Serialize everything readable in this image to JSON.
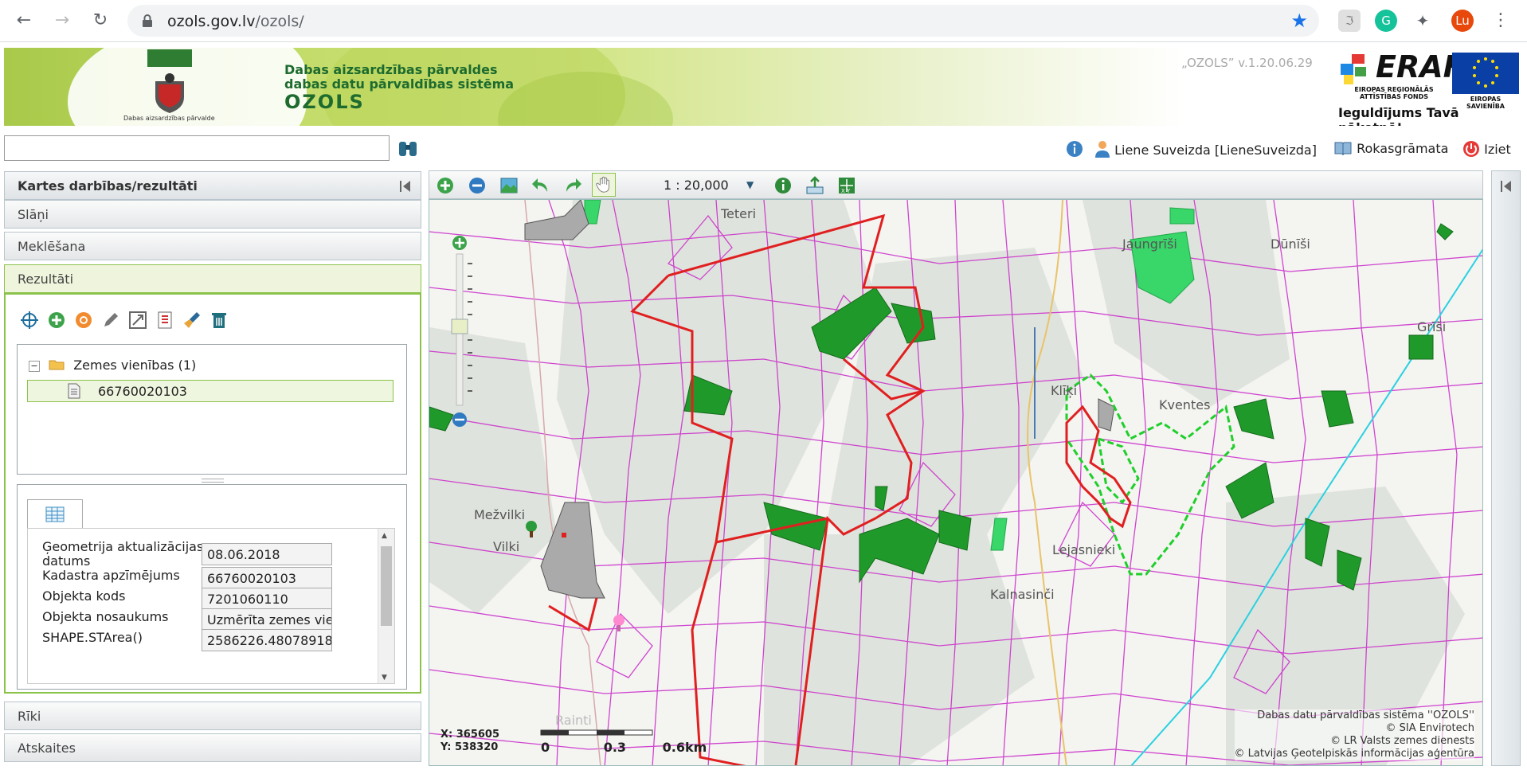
{
  "browser": {
    "url_host": "ozols.gov.lv",
    "url_path": "/ozols/",
    "avatar": "Lu"
  },
  "header": {
    "coat_label": "Dabas aizsardzības pārvalde",
    "title_line1": "Dabas aizsardzības pārvaldes",
    "title_line2": "dabas datu pārvaldības sistēma",
    "title_line3": "OZOLS",
    "version": "„OZOLS” v.1.20.06.29",
    "eraf": "ERAF",
    "eraf_sub": "EIROPAS REĢIONĀLĀS ATTĪSTĪBAS FONDS",
    "eu_sub": "EIROPAS SAVIENĪBA",
    "slogan": "Ieguldījums Tavā nākotnē!"
  },
  "userbar": {
    "user": "Liene Suveizda [LieneSuveizda]",
    "manual": "Rokasgrāmata",
    "logout": "Iziet"
  },
  "panel": {
    "title": "Kartes darbības/rezultāti",
    "sections": [
      "Slāņi",
      "Meklēšana",
      "Rezultāti",
      "Rīki",
      "Atskaites"
    ]
  },
  "results": {
    "group_label": "Zemes vienības (1)",
    "item_label": "66760020103",
    "attributes": [
      {
        "label": "Ģeometrija aktualizācijas datums",
        "value": "08.06.2018"
      },
      {
        "label": "Kadastra apzīmējums",
        "value": "66760020103"
      },
      {
        "label": "Objekta kods",
        "value": "7201060110"
      },
      {
        "label": "Objekta nosaukums",
        "value": "Uzmērīta zemes vie"
      },
      {
        "label": "SHAPE.STArea()",
        "value": "2586226.48078918"
      }
    ]
  },
  "map": {
    "scale": "1 : 20,000",
    "labels": [
      "Teteri",
      "Jaungrīši",
      "Dūnīši",
      "Grīši",
      "Klīķi",
      "Kventes",
      "Mežvilki",
      "Vilki",
      "Lejasnieki",
      "Kalnasinči",
      "Rainti"
    ],
    "coord_x": "X: 365605",
    "coord_y": "Y: 538320",
    "scalebar": [
      "0",
      "0.3",
      "0.6km"
    ],
    "credits": [
      "Dabas datu pārvaldības sistēma ''OZOLS''",
      "© SIA Envirotech",
      "© LR Valsts zemes dienests",
      "© Latvijas Ģeotelpiskās informācijas aģentūra"
    ]
  },
  "colors": {
    "accent_green": "#8bc34a",
    "parcel_line": "#cc33cc",
    "boundary_red": "#e02020",
    "forest_green": "#1f9a2a"
  }
}
